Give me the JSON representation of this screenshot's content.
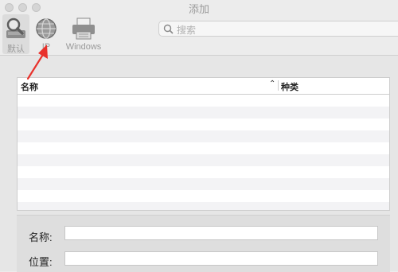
{
  "window": {
    "title": "添加"
  },
  "toolbar": {
    "items": [
      {
        "label": "默认",
        "icon": "magnifier-icon",
        "selected": true
      },
      {
        "label": "IP",
        "icon": "globe-icon",
        "selected": false
      },
      {
        "label": "Windows",
        "icon": "printer-icon",
        "selected": false
      }
    ],
    "search_placeholder": "搜索",
    "search_label": "搜索"
  },
  "table": {
    "columns": [
      "名称",
      "种类"
    ],
    "row_count": 10
  },
  "form": {
    "name_label": "名称:",
    "location_label": "位置:",
    "name_value": "",
    "location_value": ""
  },
  "colors": {
    "annotation_arrow": "#e8312b"
  }
}
